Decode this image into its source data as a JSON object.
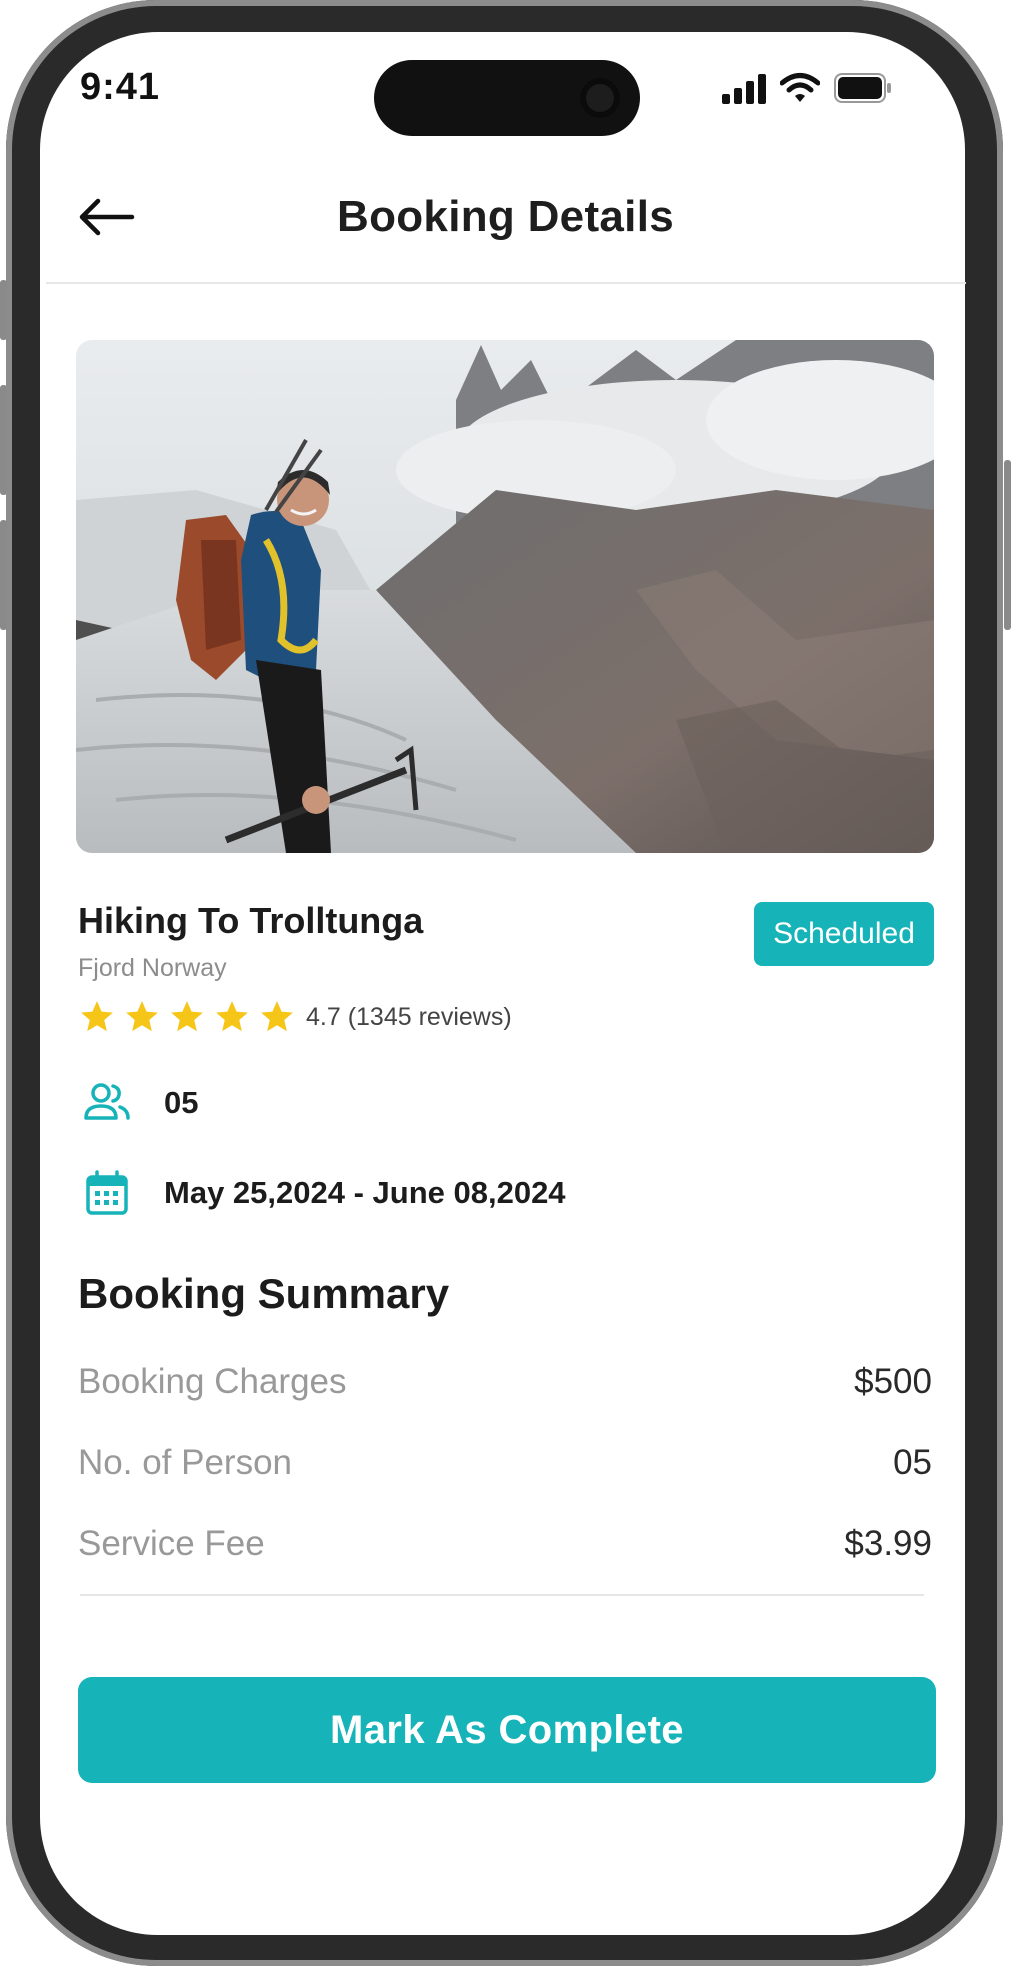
{
  "status_bar": {
    "time": "9:41"
  },
  "header": {
    "title": "Booking Details"
  },
  "tour": {
    "name": "Hiking To Trolltunga",
    "location": "Fjord Norway",
    "status": "Scheduled",
    "rating": 4.7,
    "rating_text": "4.7 (1345 reviews)",
    "stars": 5,
    "persons": "05",
    "dates": "May 25,2024 - June 08,2024"
  },
  "summary": {
    "title": "Booking Summary",
    "rows": [
      {
        "label": "Booking Charges",
        "value": "$500"
      },
      {
        "label": "No. of Person",
        "value": "05"
      },
      {
        "label": "Service Fee",
        "value": "$3.99"
      }
    ]
  },
  "cta": {
    "label": "Mark As Complete"
  },
  "colors": {
    "accent": "#16b3b8",
    "star": "#f5c518",
    "text": "#1c1c1c",
    "muted": "#999999"
  }
}
